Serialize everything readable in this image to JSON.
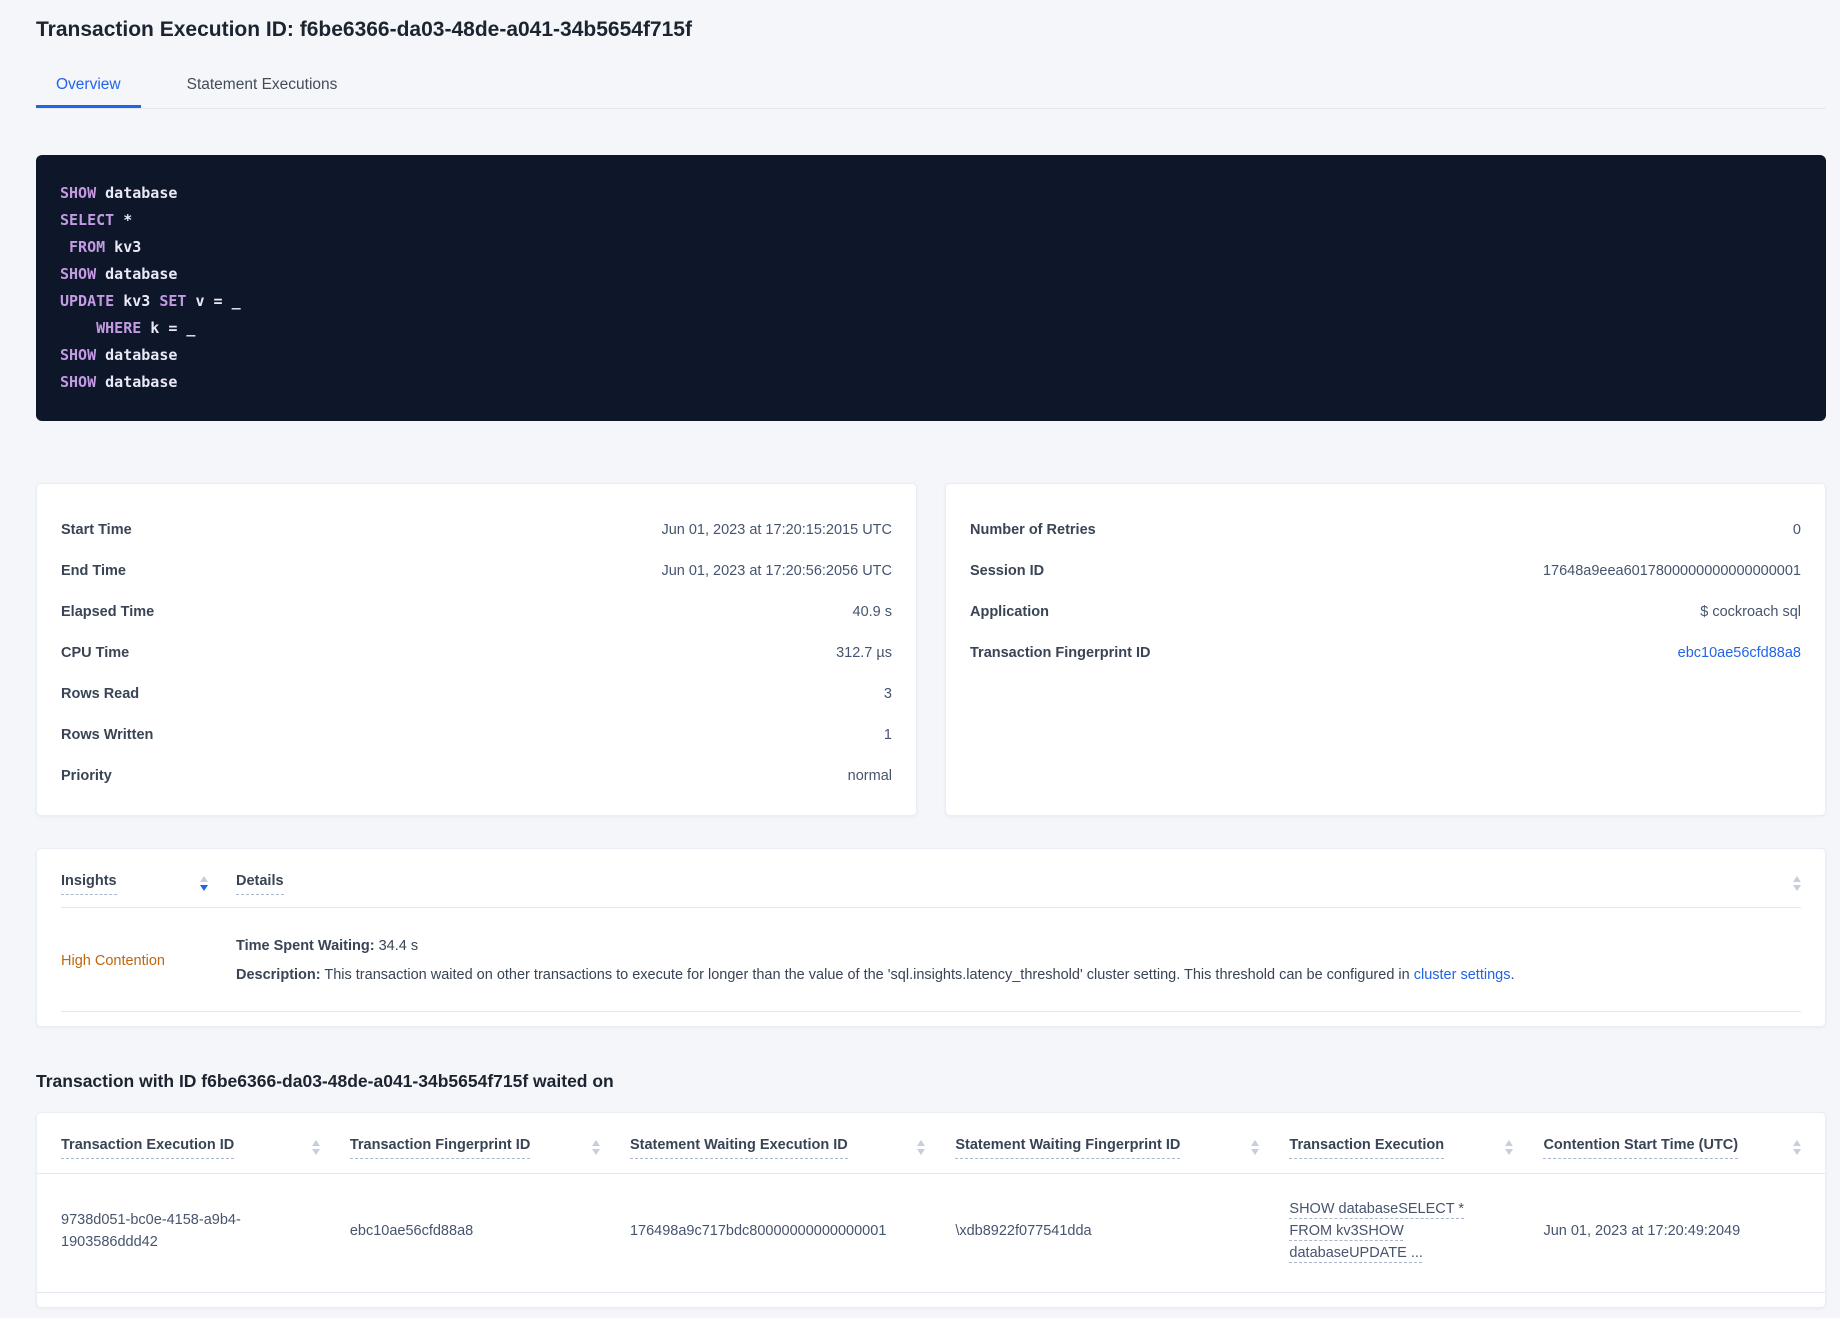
{
  "page": {
    "title": "Transaction Execution ID: f6be6366-da03-48de-a041-34b5654f715f"
  },
  "tabs": {
    "overview": "Overview",
    "statement_executions": "Statement Executions"
  },
  "sql": {
    "lines": [
      {
        "t0": "SHOW",
        "t1": " database",
        "t2": "",
        "t3": ""
      },
      {
        "t0": "SELECT",
        "t1": " *",
        "t2": "",
        "t3": ""
      },
      {
        "t0": " FROM",
        "t1": " kv3",
        "t2": "",
        "t3": ""
      },
      {
        "t0": "SHOW",
        "t1": " database",
        "t2": "",
        "t3": ""
      },
      {
        "t0": "UPDATE",
        "t1": " kv3 ",
        "t2": "SET",
        "t3": " v = _"
      },
      {
        "t0": "    WHERE",
        "t1": " k = _",
        "t2": "",
        "t3": ""
      },
      {
        "t0": "SHOW",
        "t1": " database",
        "t2": "",
        "t3": ""
      },
      {
        "t0": "SHOW",
        "t1": " database",
        "t2": "",
        "t3": ""
      }
    ]
  },
  "summary": {
    "left": {
      "rows": [
        {
          "label": "Start Time",
          "value": "Jun 01, 2023 at 17:20:15:2015 UTC"
        },
        {
          "label": "End Time",
          "value": "Jun 01, 2023 at 17:20:56:2056 UTC"
        },
        {
          "label": "Elapsed Time",
          "value": "40.9 s"
        },
        {
          "label": "CPU Time",
          "value": "312.7 µs"
        },
        {
          "label": "Rows Read",
          "value": "3"
        },
        {
          "label": "Rows Written",
          "value": "1"
        },
        {
          "label": "Priority",
          "value": "normal"
        }
      ]
    },
    "right": {
      "rows": [
        {
          "label": "Number of Retries",
          "value": "0"
        },
        {
          "label": "Session ID",
          "value": "17648a9eea6017800000000000000001"
        },
        {
          "label": "Application",
          "value": "$ cockroach sql"
        },
        {
          "label": "Transaction Fingerprint ID",
          "value": "ebc10ae56cfd88a8"
        }
      ]
    }
  },
  "insights": {
    "header": {
      "insights": "Insights",
      "details": "Details"
    },
    "row": {
      "insight": "High Contention",
      "waiting_label": "Time Spent Waiting:",
      "waiting_value": " 34.4 s",
      "description_label": "Description:",
      "description_text": " This transaction waited on other transactions to execute for longer than the value of the 'sql.insights.latency_threshold' cluster setting. This threshold can be configured in ",
      "description_link": "cluster settings",
      "description_end": "."
    }
  },
  "waited_on": {
    "title": "Transaction with ID f6be6366-da03-48de-a041-34b5654f715f waited on",
    "headers": [
      "Transaction Execution ID",
      "Transaction Fingerprint ID",
      "Statement Waiting Execution ID",
      "Statement Waiting Fingerprint ID",
      "Transaction Execution",
      "Contention Start Time (UTC)"
    ],
    "row": {
      "transaction_execution_id": "9738d051-bc0e-4158-a9b4-1903586ddd42",
      "transaction_fingerprint_id": "ebc10ae56cfd88a8",
      "statement_waiting_execution_id": "176498a9c717bdc80000000000000001",
      "statement_waiting_fingerprint_id": "\\xdb8922f077541dda",
      "transaction_execution": "SHOW databaseSELECT * FROM kv3SHOW databaseUPDATE ...",
      "contention_start_time": "Jun 01, 2023 at 17:20:49:2049"
    }
  },
  "colors": {
    "accent_blue": "#2264e8",
    "insight_orange": "#c0660d",
    "code_background": "#0d1729",
    "code_keyword": "#c49ae2",
    "code_text": "#ece9f6"
  }
}
